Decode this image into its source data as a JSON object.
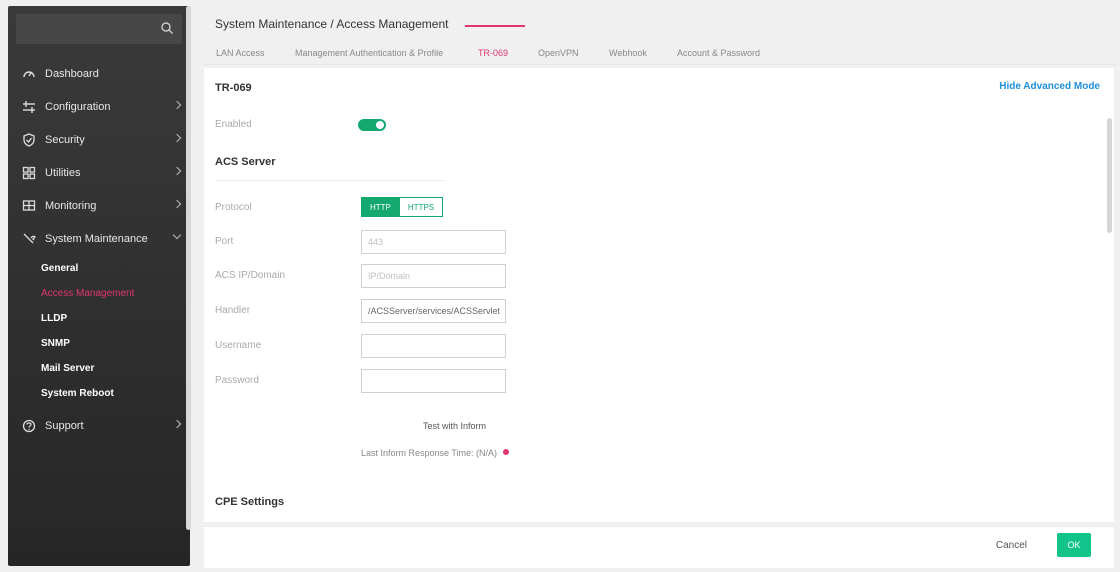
{
  "sidebar": {
    "search": {
      "placeholder": ""
    },
    "items": [
      {
        "label": "Dashboard",
        "icon": "dashboard-icon"
      },
      {
        "label": "Configuration",
        "icon": "configuration-icon"
      },
      {
        "label": "Security",
        "icon": "shield-icon"
      },
      {
        "label": "Utilities",
        "icon": "grid-icon"
      },
      {
        "label": "Monitoring",
        "icon": "monitor-icon"
      },
      {
        "label": "System Maintenance",
        "icon": "wrench-icon"
      },
      {
        "label": "Support",
        "icon": "help-icon"
      }
    ],
    "subitems": [
      {
        "label": "General"
      },
      {
        "label": "Access Management"
      },
      {
        "label": "LLDP"
      },
      {
        "label": "SNMP"
      },
      {
        "label": "Mail Server"
      },
      {
        "label": "System Reboot"
      }
    ]
  },
  "breadcrumb": "System Maintenance / Access Management",
  "tabs": [
    {
      "label": "LAN Access"
    },
    {
      "label": "Management Authentication & Profile"
    },
    {
      "label": "TR-069"
    },
    {
      "label": "OpenVPN"
    },
    {
      "label": "Webhook"
    },
    {
      "label": "Account & Password"
    }
  ],
  "panel": {
    "title": "TR-069",
    "hide_advanced": "Hide Advanced Mode",
    "enabled_label": "Enabled",
    "acs_section": "ACS Server",
    "protocol_label": "Protocol",
    "protocol_options": [
      "HTTP",
      "HTTPS"
    ],
    "port_label": "Port",
    "port_placeholder": "443",
    "acs_ip_label": "ACS IP/Domain",
    "acs_ip_placeholder": "IP/Domain",
    "handler_label": "Handler",
    "handler_value": "/ACSServer/services/ACSServlet",
    "username_label": "Username",
    "password_label": "Password",
    "test_inform": "Test with Inform",
    "last_inform": "Last Inform Response Time: (N/A)",
    "cpe_section": "CPE Settings"
  },
  "footer": {
    "cancel": "Cancel",
    "ok": "OK"
  },
  "colors": {
    "accent": "#13a86f",
    "active_tab": "#e0366e",
    "link": "#1e90d8"
  }
}
